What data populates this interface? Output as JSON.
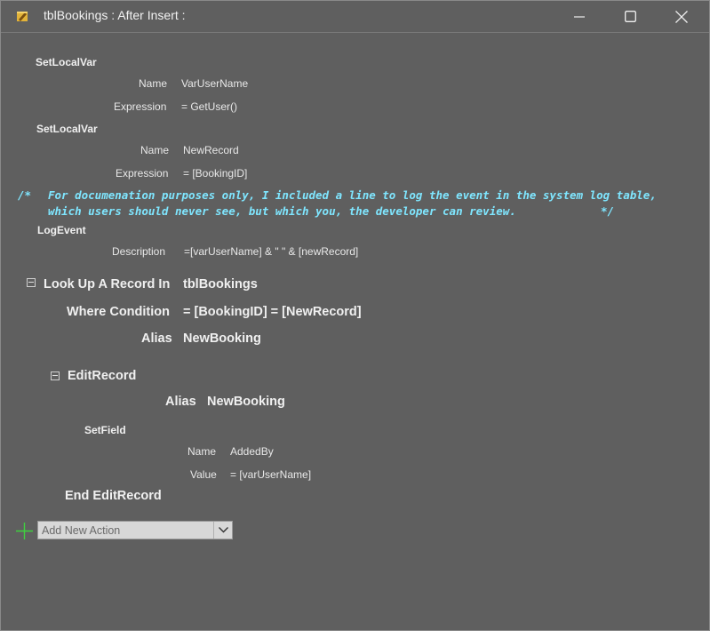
{
  "window": {
    "title": "tblBookings : After Insert :",
    "icons": {
      "app": "macro-icon",
      "minimize": "minimize-icon",
      "maximize": "maximize-icon",
      "close": "close-icon"
    }
  },
  "actions": {
    "setlocalvar1": {
      "name_label": "SetLocalVar",
      "name_field_label": "Name",
      "name_value": "VarUserName",
      "expr_label": "Expression",
      "expr_value": "= GetUser()"
    },
    "setlocalvar2": {
      "name_label": "SetLocalVar",
      "name_field_label": "Name",
      "name_value": "NewRecord",
      "expr_label": "Expression",
      "expr_value": "= [BookingID]"
    },
    "comment": {
      "open": "/*",
      "line1": "For documenation purposes only, I included a line to log the event in the system log table,",
      "line2": "which users should never see, but which you, the developer can review.",
      "close": "*/"
    },
    "logevent": {
      "label": "LogEvent",
      "desc_label": "Description",
      "desc_value": "=[varUserName] & \" \" & [newRecord]"
    },
    "lookup": {
      "label": "Look Up A Record In",
      "table": "tblBookings",
      "where_label": "Where Condition",
      "where_value": "= [BookingID] = [NewRecord]",
      "alias_label": "Alias",
      "alias_value": "NewBooking"
    },
    "editrecord": {
      "label": "EditRecord",
      "alias_label": "Alias",
      "alias_value": "NewBooking",
      "setfield": {
        "label": "SetField",
        "name_label": "Name",
        "name_value": "AddedBy",
        "value_label": "Value",
        "value_value": "= [varUserName]"
      },
      "end_label": "End EditRecord"
    }
  },
  "add_action": {
    "placeholder": "Add New Action",
    "icon": "plus-icon",
    "dropdown_icon": "chevron-down-icon"
  },
  "colors": {
    "background": "#5f5f5f",
    "comment": "#7fe6ff",
    "plus": "#3fd13f"
  }
}
